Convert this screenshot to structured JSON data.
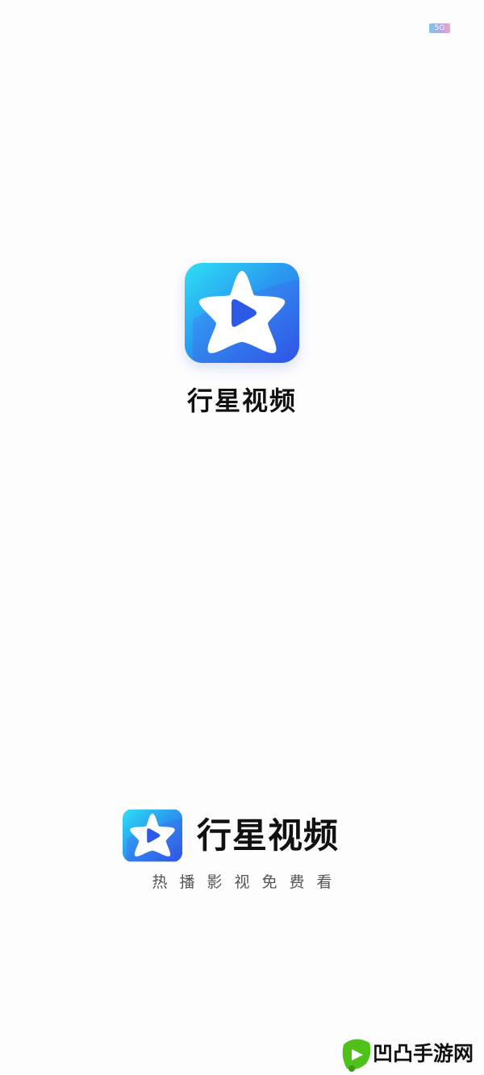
{
  "status_bar": {
    "badge_text": "5G"
  },
  "splash": {
    "app_icon": "star-play-icon",
    "app_name": "行星视频"
  },
  "footer": {
    "app_icon": "star-play-icon",
    "app_name": "行星视频",
    "slogan": "热播影视免费看"
  },
  "watermark": {
    "logo_icon": "green-leaf-play-icon",
    "text": "凹凸手游网"
  },
  "colors": {
    "background": "#fdfdfe",
    "icon_gradient_start": "#27d8f3",
    "icon_gradient_end": "#2f62ea",
    "play_triangle": "#2c59e8",
    "title_text": "#111111",
    "slogan_text": "#555555",
    "watermark_green": "#4fc21a"
  }
}
